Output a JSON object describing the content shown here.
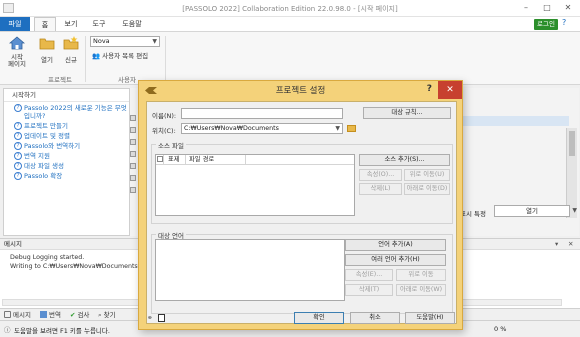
{
  "window": {
    "title": "[PASSOLO 2022] Collaboration Edition 22.0.98.0 - [시작 페이지]"
  },
  "menubar": {
    "tabs": [
      "파일",
      "홈",
      "보기",
      "도구",
      "도움말"
    ],
    "active_tab": "홈",
    "login_label": "로그인"
  },
  "ribbon": {
    "buttons": [
      {
        "label": "시작\n페이지"
      },
      {
        "label": "열기"
      },
      {
        "label": "신규"
      }
    ],
    "group_project": "프로젝트",
    "user_select": "Nova",
    "user_list_edit": "사용자 목록 편집",
    "group_user": "사용자"
  },
  "start_panel": {
    "header": "시작하기",
    "items": [
      "Passolo 2022의 새로운 기능은 무엇입니까?",
      "프로젝트 만들기",
      "업데이트 및 정렬",
      "Passolo와 번역하기",
      "번역 지원",
      "대상 파일 생성",
      "Passolo 확장"
    ]
  },
  "background": {
    "show_label": "표시 특정",
    "show_value": "열기"
  },
  "messages": {
    "header": "메시지",
    "lines": [
      "Debug Logging started.",
      "Writing to C:₩Users₩Nova₩Documents₩Pa"
    ]
  },
  "bottom_tabs": [
    "메시지",
    "번역",
    "검사",
    "찾기"
  ],
  "status": {
    "hint": "도움말을 보려면 F1 키를 누릅니다.",
    "progress": "0 %"
  },
  "dialog": {
    "title": "프로젝트 설정",
    "help": "?",
    "close": "✕",
    "name_label": "이름(N):",
    "name_value": "",
    "rules_button": "대상 규칙...",
    "location_label": "위치(C):",
    "location_value": "C:₩Users₩Nova₩Documents",
    "source_group": "소스 파일",
    "source_columns": [
      "표제",
      "파일 경로"
    ],
    "source_buttons": {
      "add": "소스 추가(S)...",
      "props": "속성(O)...",
      "move_up": "위로 이동(U)",
      "delete": "삭제(L)",
      "move_down": "아래로 이동(D)"
    },
    "target_group": "대상 언어",
    "target_buttons": {
      "add_lang": "언어 추가(A)",
      "add_multi": "여러 언어 추가(H)",
      "props": "속성(E)...",
      "move_up": "위로 이동",
      "delete": "삭제(T)",
      "move_down": "아래로 이동(W)"
    },
    "footer": {
      "ok": "확인",
      "cancel": "취소",
      "help": "도움말(H)"
    }
  }
}
